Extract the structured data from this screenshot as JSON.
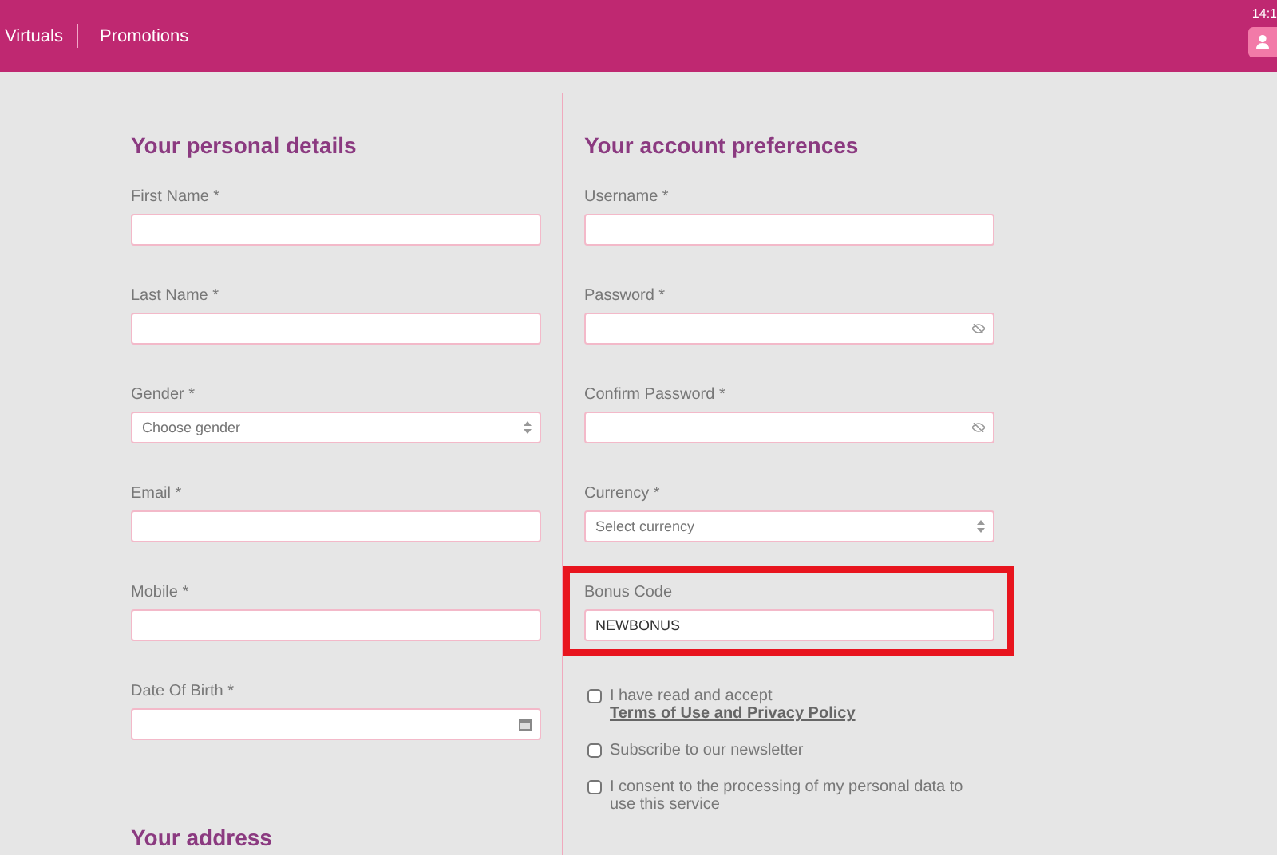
{
  "header": {
    "nav": [
      "Virtuals",
      "Promotions"
    ],
    "time": "14:1"
  },
  "personal": {
    "title": "Your personal details",
    "fields": [
      {
        "label": "First Name *",
        "kind": "text"
      },
      {
        "label": "Last Name *",
        "kind": "text"
      },
      {
        "label": "Gender *",
        "kind": "select",
        "placeholder": "Choose gender"
      },
      {
        "label": "Email *",
        "kind": "text"
      },
      {
        "label": "Mobile *",
        "kind": "text"
      },
      {
        "label": "Date Of Birth *",
        "kind": "date"
      }
    ]
  },
  "address": {
    "title": "Your address"
  },
  "account": {
    "title": "Your account preferences",
    "fields": [
      {
        "label": "Username *",
        "kind": "text"
      },
      {
        "label": "Password *",
        "kind": "password"
      },
      {
        "label": "Confirm Password *",
        "kind": "password"
      },
      {
        "label": "Currency *",
        "kind": "select",
        "placeholder": "Select currency"
      },
      {
        "label": "Bonus Code",
        "kind": "text",
        "value": "NEWBONUS",
        "highlighted": true
      }
    ],
    "checkboxes": [
      {
        "text": "I have read and accept",
        "link": "Terms of Use and Privacy Policy",
        "checked": false
      },
      {
        "text": "Subscribe to our newsletter",
        "checked": false
      },
      {
        "text": "I consent to the processing of my personal data to use this service",
        "checked": false
      }
    ]
  }
}
